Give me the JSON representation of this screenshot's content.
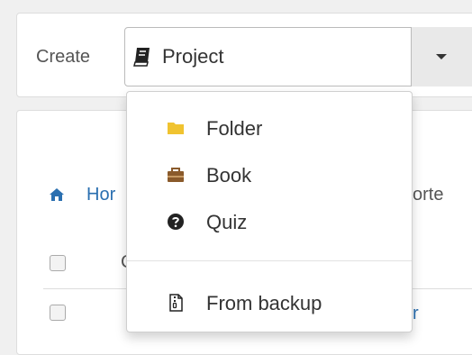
{
  "top_fragment": "",
  "create": {
    "label": "Create",
    "selected": "Project",
    "selected_icon": "book-icon"
  },
  "dropdown": {
    "items": [
      {
        "label": "Folder",
        "icon": "folder-icon",
        "color": "#f0c330"
      },
      {
        "label": "Book",
        "icon": "briefcase-icon",
        "color": "#8a5a2b"
      },
      {
        "label": "Quiz",
        "icon": "question-circle-icon",
        "color": "#222222"
      }
    ],
    "backup": {
      "label": "From backup",
      "icon": "archive-file-icon"
    }
  },
  "breadcrumb": {
    "home": "Hor"
  },
  "partials": {
    "right_header": "orte",
    "row_link": "r",
    "column_c": "C"
  },
  "colors": {
    "link": "#2a6fb0",
    "folder": "#f0c330"
  }
}
